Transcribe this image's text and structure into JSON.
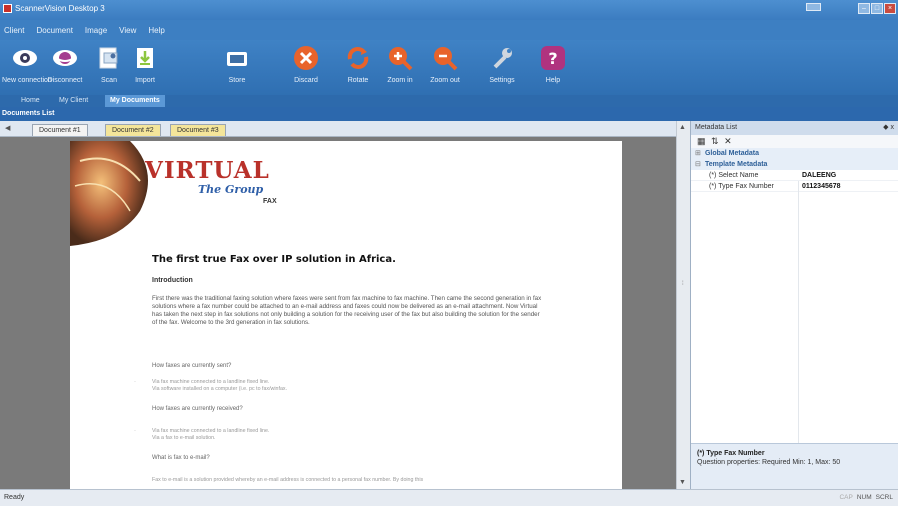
{
  "window": {
    "title": "ScannerVision Desktop 3"
  },
  "menu": [
    "Client",
    "Document",
    "Image",
    "View",
    "Help"
  ],
  "toolbar": [
    {
      "label": "New connection",
      "icon": "eye-icon"
    },
    {
      "label": "Disconnect",
      "icon": "eye-closed-icon"
    },
    {
      "label": "Scan",
      "icon": "scan-icon"
    },
    {
      "label": "Import",
      "icon": "import-icon"
    },
    {
      "label": "Store",
      "icon": "folder-icon"
    },
    {
      "label": "Discard",
      "icon": "discard-icon"
    },
    {
      "label": "Rotate",
      "icon": "rotate-icon"
    },
    {
      "label": "Zoom in",
      "icon": "zoom-in-icon"
    },
    {
      "label": "Zoom out",
      "icon": "zoom-out-icon"
    },
    {
      "label": "Settings",
      "icon": "wrench-icon"
    },
    {
      "label": "Help",
      "icon": "help-icon"
    }
  ],
  "ribbon_tabs": [
    "Home",
    "My Client",
    "My Documents"
  ],
  "documents_list": {
    "title": "Documents List"
  },
  "document_tabs": [
    "Document #1",
    "Document #2",
    "Document #3"
  ],
  "document": {
    "logo_title": "VIRTUAL",
    "logo_sub": "The Group",
    "logo_fax": "FAX",
    "heading": "The first true Fax over IP solution in Africa.",
    "intro_title": "Introduction",
    "intro_text": "First there was the traditional faxing solution where faxes were sent from fax machine to fax machine. Then came the second generation in fax solutions where a fax number could be attached to an e-mail address and faxes could now be delivered as an e-mail attachment. Now Virtual has taken the next step in fax solutions not only building a solution for the receiving user of the fax but also building the solution for the sender of the fax. Welcome to the 3rd generation in fax solutions.",
    "q1": "How faxes are currently sent?",
    "q1_lines": [
      "Via fax machine connected to a landline fixed line.",
      "Via software installed on a computer (i.e. pc to fax/winfax."
    ],
    "q2": "How faxes are currently received?",
    "q2_lines": [
      "Via fax machine connected to a landline fixed line.",
      "Via a fax to e-mail solution."
    ],
    "q3": "What is fax to e-mail?",
    "q3_text": "Fax to e-mail is a solution provided whereby an e-mail address is connected to a personal fax number. By doing this"
  },
  "metadata": {
    "title": "Metadata List",
    "pin": "◆ x",
    "toolbar_icons": [
      "grid-icon",
      "sort-icon",
      "clear-icon"
    ],
    "toolbar_glyphs": [
      "▦",
      "⇅",
      "✕"
    ],
    "groups": [
      {
        "name": "Global Metadata",
        "expander": "⊞"
      },
      {
        "name": "Template Metadata",
        "expander": "⊟"
      }
    ],
    "properties": [
      {
        "name": "(*) Select Name",
        "value": "DALEENG"
      },
      {
        "name": "(*) Type Fax Number",
        "value": "0112345678"
      }
    ],
    "description": {
      "title": "(*) Type Fax Number",
      "text": "Question properties: Required Min: 1, Max: 50"
    }
  },
  "status": {
    "text": "Ready",
    "keys": [
      {
        "label": "CAP",
        "active": false
      },
      {
        "label": "NUM",
        "active": true
      },
      {
        "label": "SCRL",
        "active": true
      }
    ]
  },
  "colors": {
    "ribbon": "#3f82c5",
    "active_tab": "#5b98d6",
    "header": "#2c68ad",
    "accent_red": "#b9312a"
  }
}
